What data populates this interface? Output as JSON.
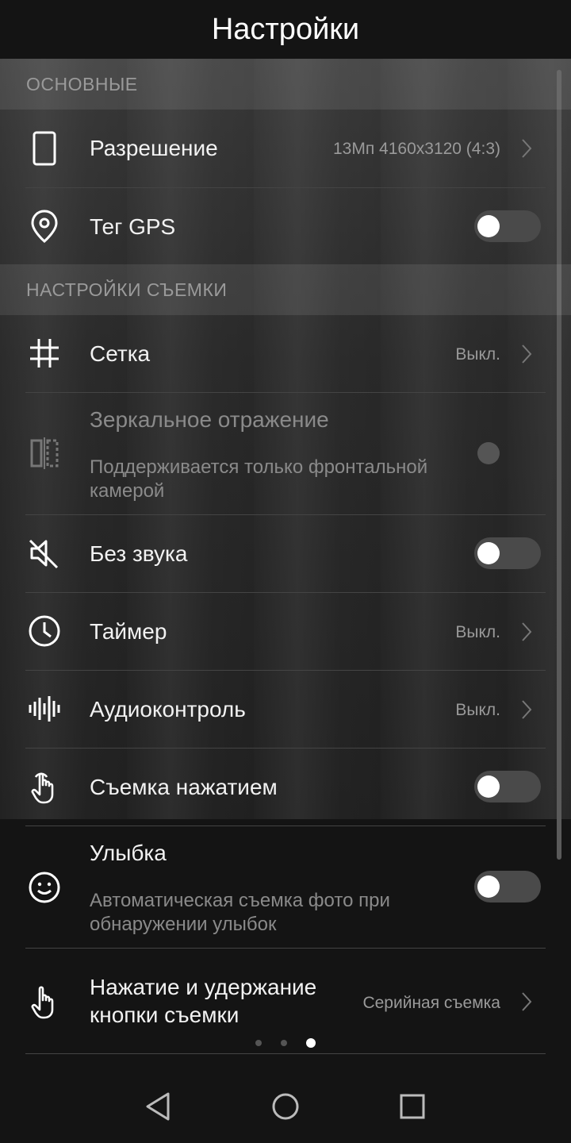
{
  "header": {
    "title": "Настройки"
  },
  "sections": {
    "basic": "ОСНОВНЫЕ",
    "shooting": "НАСТРОЙКИ СЪЕМКИ"
  },
  "settings": {
    "resolution": {
      "label": "Разрешение",
      "value": "13Мп 4160x3120 (4:3)"
    },
    "gps": {
      "label": "Тег GPS",
      "enabled": false
    },
    "grid": {
      "label": "Сетка",
      "value": "Выкл."
    },
    "mirror": {
      "label": "Зеркальное отражение",
      "sub": "Поддерживается только фронтальной камерой"
    },
    "mute": {
      "label": "Без звука",
      "enabled": false
    },
    "timer": {
      "label": "Таймер",
      "value": "Выкл."
    },
    "audio": {
      "label": "Аудиоконтроль",
      "value": "Выкл."
    },
    "touch": {
      "label": "Съемка нажатием",
      "enabled": false
    },
    "smile": {
      "label": "Улыбка",
      "sub": "Автоматическая съемка фото при обнаружении улыбок",
      "enabled": false
    },
    "hold": {
      "label_line1": "Нажатие и удержание",
      "label_line2": "кнопки съемки",
      "value": "Серийная съемка"
    }
  },
  "pager": {
    "count": 3,
    "active": 3
  }
}
